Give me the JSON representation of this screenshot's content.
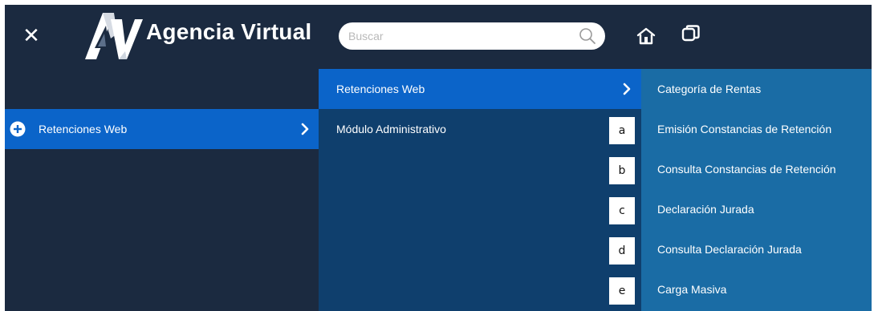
{
  "header": {
    "close_label": "✕",
    "logo_text": "AV",
    "brand": "Agencia Virtual",
    "search_placeholder": "Buscar"
  },
  "icons": {
    "close": "close-icon",
    "logo": "agencia-virtual-logo",
    "search": "search-icon",
    "home": "home-icon",
    "windows": "windows-icon",
    "plus": "plus-circle-icon",
    "chevron": "chevron-right-icon"
  },
  "colors": {
    "background": "#1b2a40",
    "active": "#0b64c9",
    "submenu": "#0f3f6d",
    "submenu_level3": "#1a6ca5"
  },
  "menu": {
    "level1": [
      {
        "label": "Retenciones Web",
        "active": true
      }
    ],
    "level2": [
      {
        "label": "Retenciones Web",
        "active": true
      },
      {
        "label": "Módulo Administrativo",
        "active": false
      }
    ],
    "level3": [
      {
        "label": "Categoría de Rentas"
      },
      {
        "label": "Emisión Constancias de Retención"
      },
      {
        "label": "Consulta Constancias de Retención"
      },
      {
        "label": "Declaración Jurada"
      },
      {
        "label": "Consulta Declaración Jurada"
      },
      {
        "label": "Carga Masiva"
      }
    ]
  },
  "markers": [
    "a",
    "b",
    "c",
    "d",
    "e"
  ]
}
